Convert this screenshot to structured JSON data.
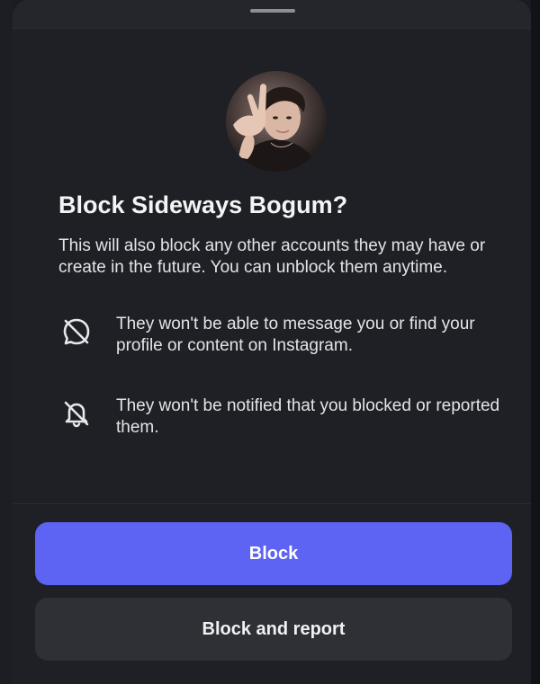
{
  "dialog": {
    "title": "Block Sideways Bogum?",
    "description": "This will also block any other accounts they may have or create in the future. You can unblock them anytime.",
    "avatar_icon": "profile-photo",
    "items": [
      {
        "icon": "message-off-icon",
        "text": "They won't be able to message you or find your profile or content on Instagram."
      },
      {
        "icon": "bell-off-icon",
        "text": "They won't be notified that you blocked or reported them."
      }
    ],
    "primary_button": "Block",
    "secondary_button": "Block and report"
  },
  "colors": {
    "accent": "#5d63f3",
    "sheet_bg": "#1f2025",
    "secondary_button_bg": "#2f3036",
    "text_primary": "#f4f4f6"
  }
}
